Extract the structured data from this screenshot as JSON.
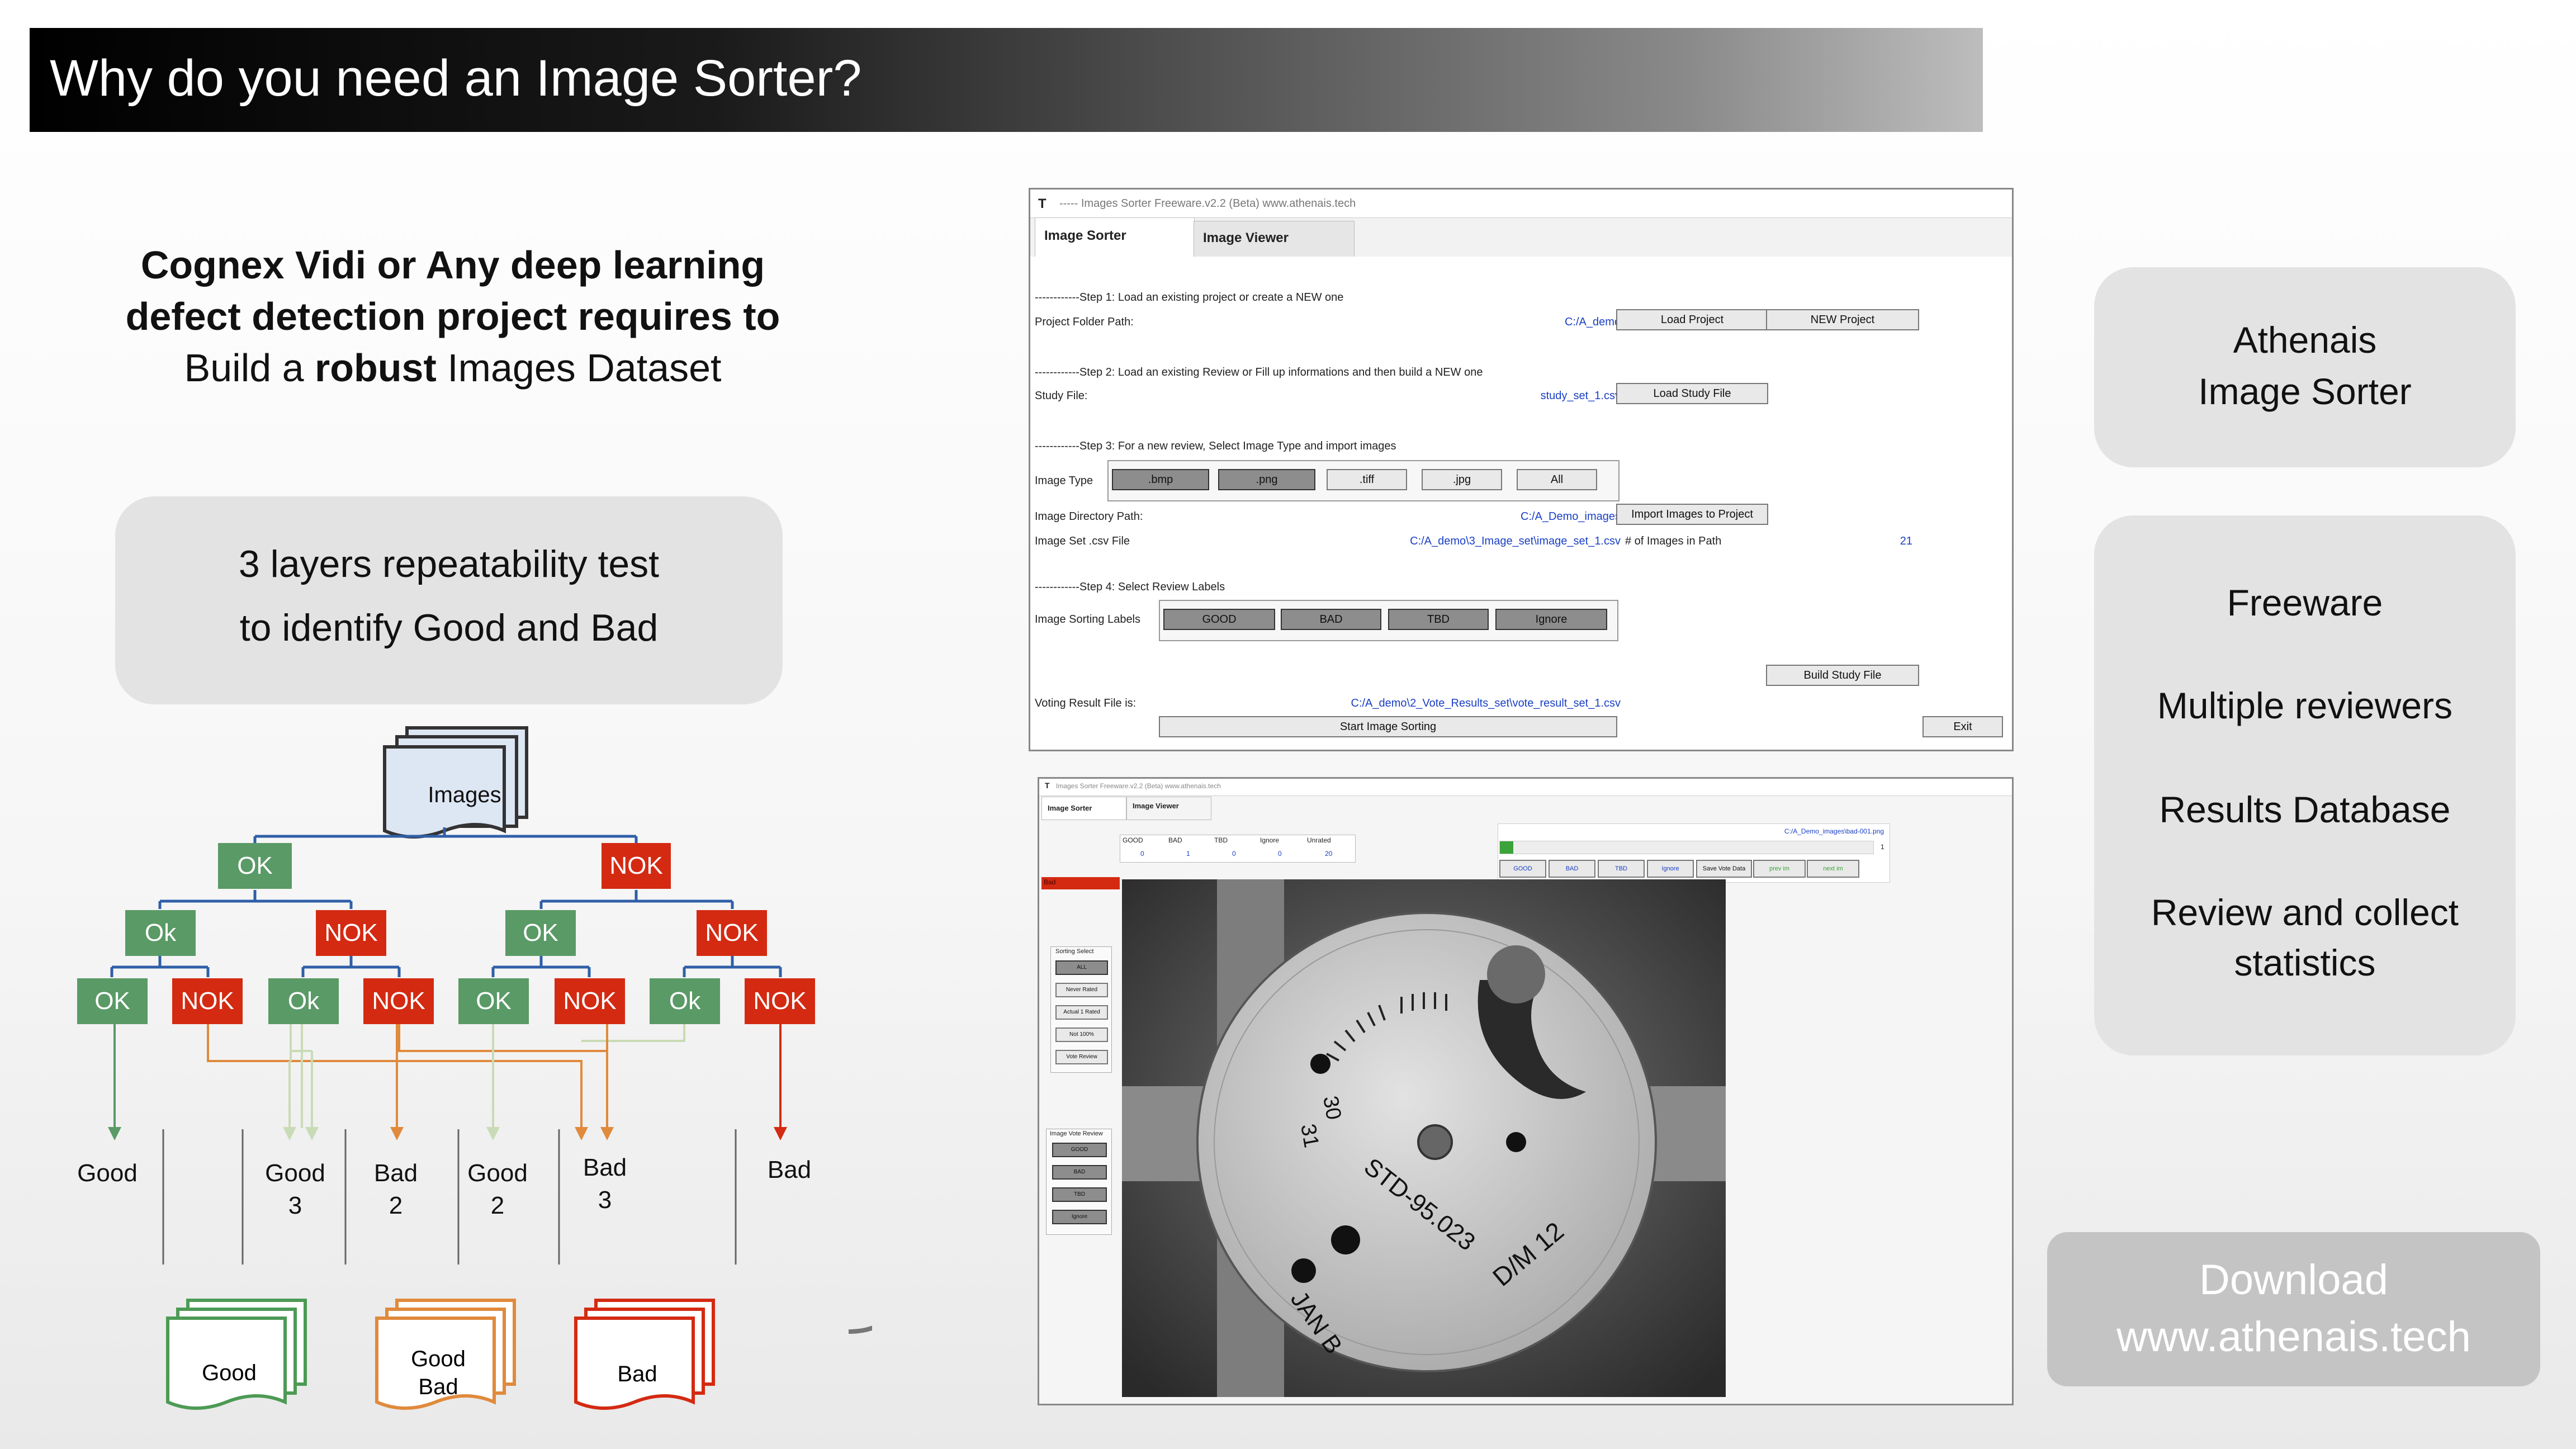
{
  "header": {
    "title": "Why do you need an Image Sorter?"
  },
  "intro": {
    "line1": "Cognex Vidi or Any deep learning",
    "line2": "defect detection project requires to",
    "line3_pre": "Build a ",
    "line3_bold": "robust",
    "line3_post": " Images Dataset"
  },
  "layers_box": {
    "line1": "3 layers repeatability test",
    "line2": "to identify Good and Bad"
  },
  "tree": {
    "root": "Images",
    "level1": [
      "OK",
      "NOK"
    ],
    "level2": [
      "Ok",
      "NOK",
      "OK",
      "NOK"
    ],
    "level3": [
      "OK",
      "NOK",
      "Ok",
      "NOK",
      "OK",
      "NOK",
      "Ok",
      "NOK"
    ],
    "outputs": [
      {
        "l1": "Good",
        "l2": ""
      },
      {
        "l1": "Good",
        "l2": "3"
      },
      {
        "l1": "Bad",
        "l2": "2"
      },
      {
        "l1": "Good",
        "l2": "2"
      },
      {
        "l1": "Bad",
        "l2": "3"
      },
      {
        "l1": "Bad",
        "l2": ""
      }
    ],
    "stacks": [
      {
        "l1": "Good",
        "l2": "",
        "color": "#4d9a55"
      },
      {
        "l1": "Good",
        "l2": "Bad",
        "color": "#e08a3c"
      },
      {
        "l1": "Bad",
        "l2": "",
        "color": "#d42a12"
      }
    ],
    "colors": {
      "ok": "#5a9a66",
      "nok": "#d42a12",
      "line": "#2f5fa8"
    }
  },
  "app1": {
    "window_title": "----- Images Sorter Freeware.v2.2 (Beta)  www.athenais.tech",
    "tabs": [
      "Image Sorter",
      "Image Viewer"
    ],
    "step1": "------------Step 1: Load an existing project or create a NEW one",
    "project_folder_label": "Project Folder Path:",
    "project_folder_value": "C:/A_demo",
    "load_project": "Load Project",
    "new_project": "NEW Project",
    "step2": "------------Step 2: Load an existing Review or Fill up informations and then build a NEW one",
    "study_file_label": "Study File:",
    "study_file_value": "study_set_1.csv",
    "load_study": "Load Study File",
    "step3": "------------Step 3: For a new review, Select Image Type and import images",
    "image_type_label": "Image Type",
    "image_types": [
      ".bmp",
      ".png",
      ".tiff",
      ".jpg",
      "All"
    ],
    "image_dir_label": "Image Directory Path:",
    "image_dir_value": "C:/A_Demo_images",
    "import_btn": "Import Images to Project",
    "image_set_label": "Image Set .csv File",
    "image_set_value": "C:/A_demo\\3_Image_set\\image_set_1.csv",
    "num_images_label": "# of Images in Path",
    "num_images_value": "21",
    "step4": "------------Step 4: Select Review Labels",
    "sorting_labels_label": "Image Sorting Labels",
    "sorting_labels": [
      "GOOD",
      "BAD",
      "TBD",
      "Ignore"
    ],
    "build_btn": "Build Study File",
    "voting_label": "Voting Result File is:",
    "voting_value": "C:/A_demo\\2_Vote_Results_set\\vote_result_set_1.csv",
    "start_btn": "Start Image Sorting",
    "exit_btn": "Exit"
  },
  "app2": {
    "window_title": "Images Sorter Freeware.v2.2 (Beta)  www.athenais.tech",
    "tabs": [
      "Image Sorter",
      "Image Viewer"
    ],
    "count_headers": [
      "GOOD",
      "BAD",
      "TBD",
      "Ignore",
      "Unrated"
    ],
    "count_values": [
      "0",
      "1",
      "0",
      "0",
      "20"
    ],
    "path_value": "C:/A_Demo_images\\bad-001.png",
    "page_value": "1",
    "label_buttons": [
      "GOOD",
      "BAD",
      "TBD",
      "Ignore",
      "Save Vote Data",
      "prev im",
      "next im"
    ],
    "sorting_select_title": "Sorting Select",
    "sorting_select": [
      "ALL",
      "Never Rated",
      "Actual 1 Rated",
      "Not 100%",
      "Vote Review"
    ],
    "image_vote_title": "Image Vote Review",
    "image_vote": [
      "GOOD",
      "BAD",
      "TBD",
      "Ignore"
    ],
    "status_label": "Bad",
    "dial_text": [
      "STD-95.023",
      "D/M 12",
      "JAN B",
      "31",
      "30"
    ]
  },
  "right_panel": {
    "brand_line1": "Athenais",
    "brand_line2": "Image Sorter",
    "features": [
      "Freeware",
      "Multiple reviewers",
      "Results Database",
      "Review and collect",
      "statistics"
    ],
    "download_line1": "Download",
    "download_line2": "www.athenais.tech"
  }
}
